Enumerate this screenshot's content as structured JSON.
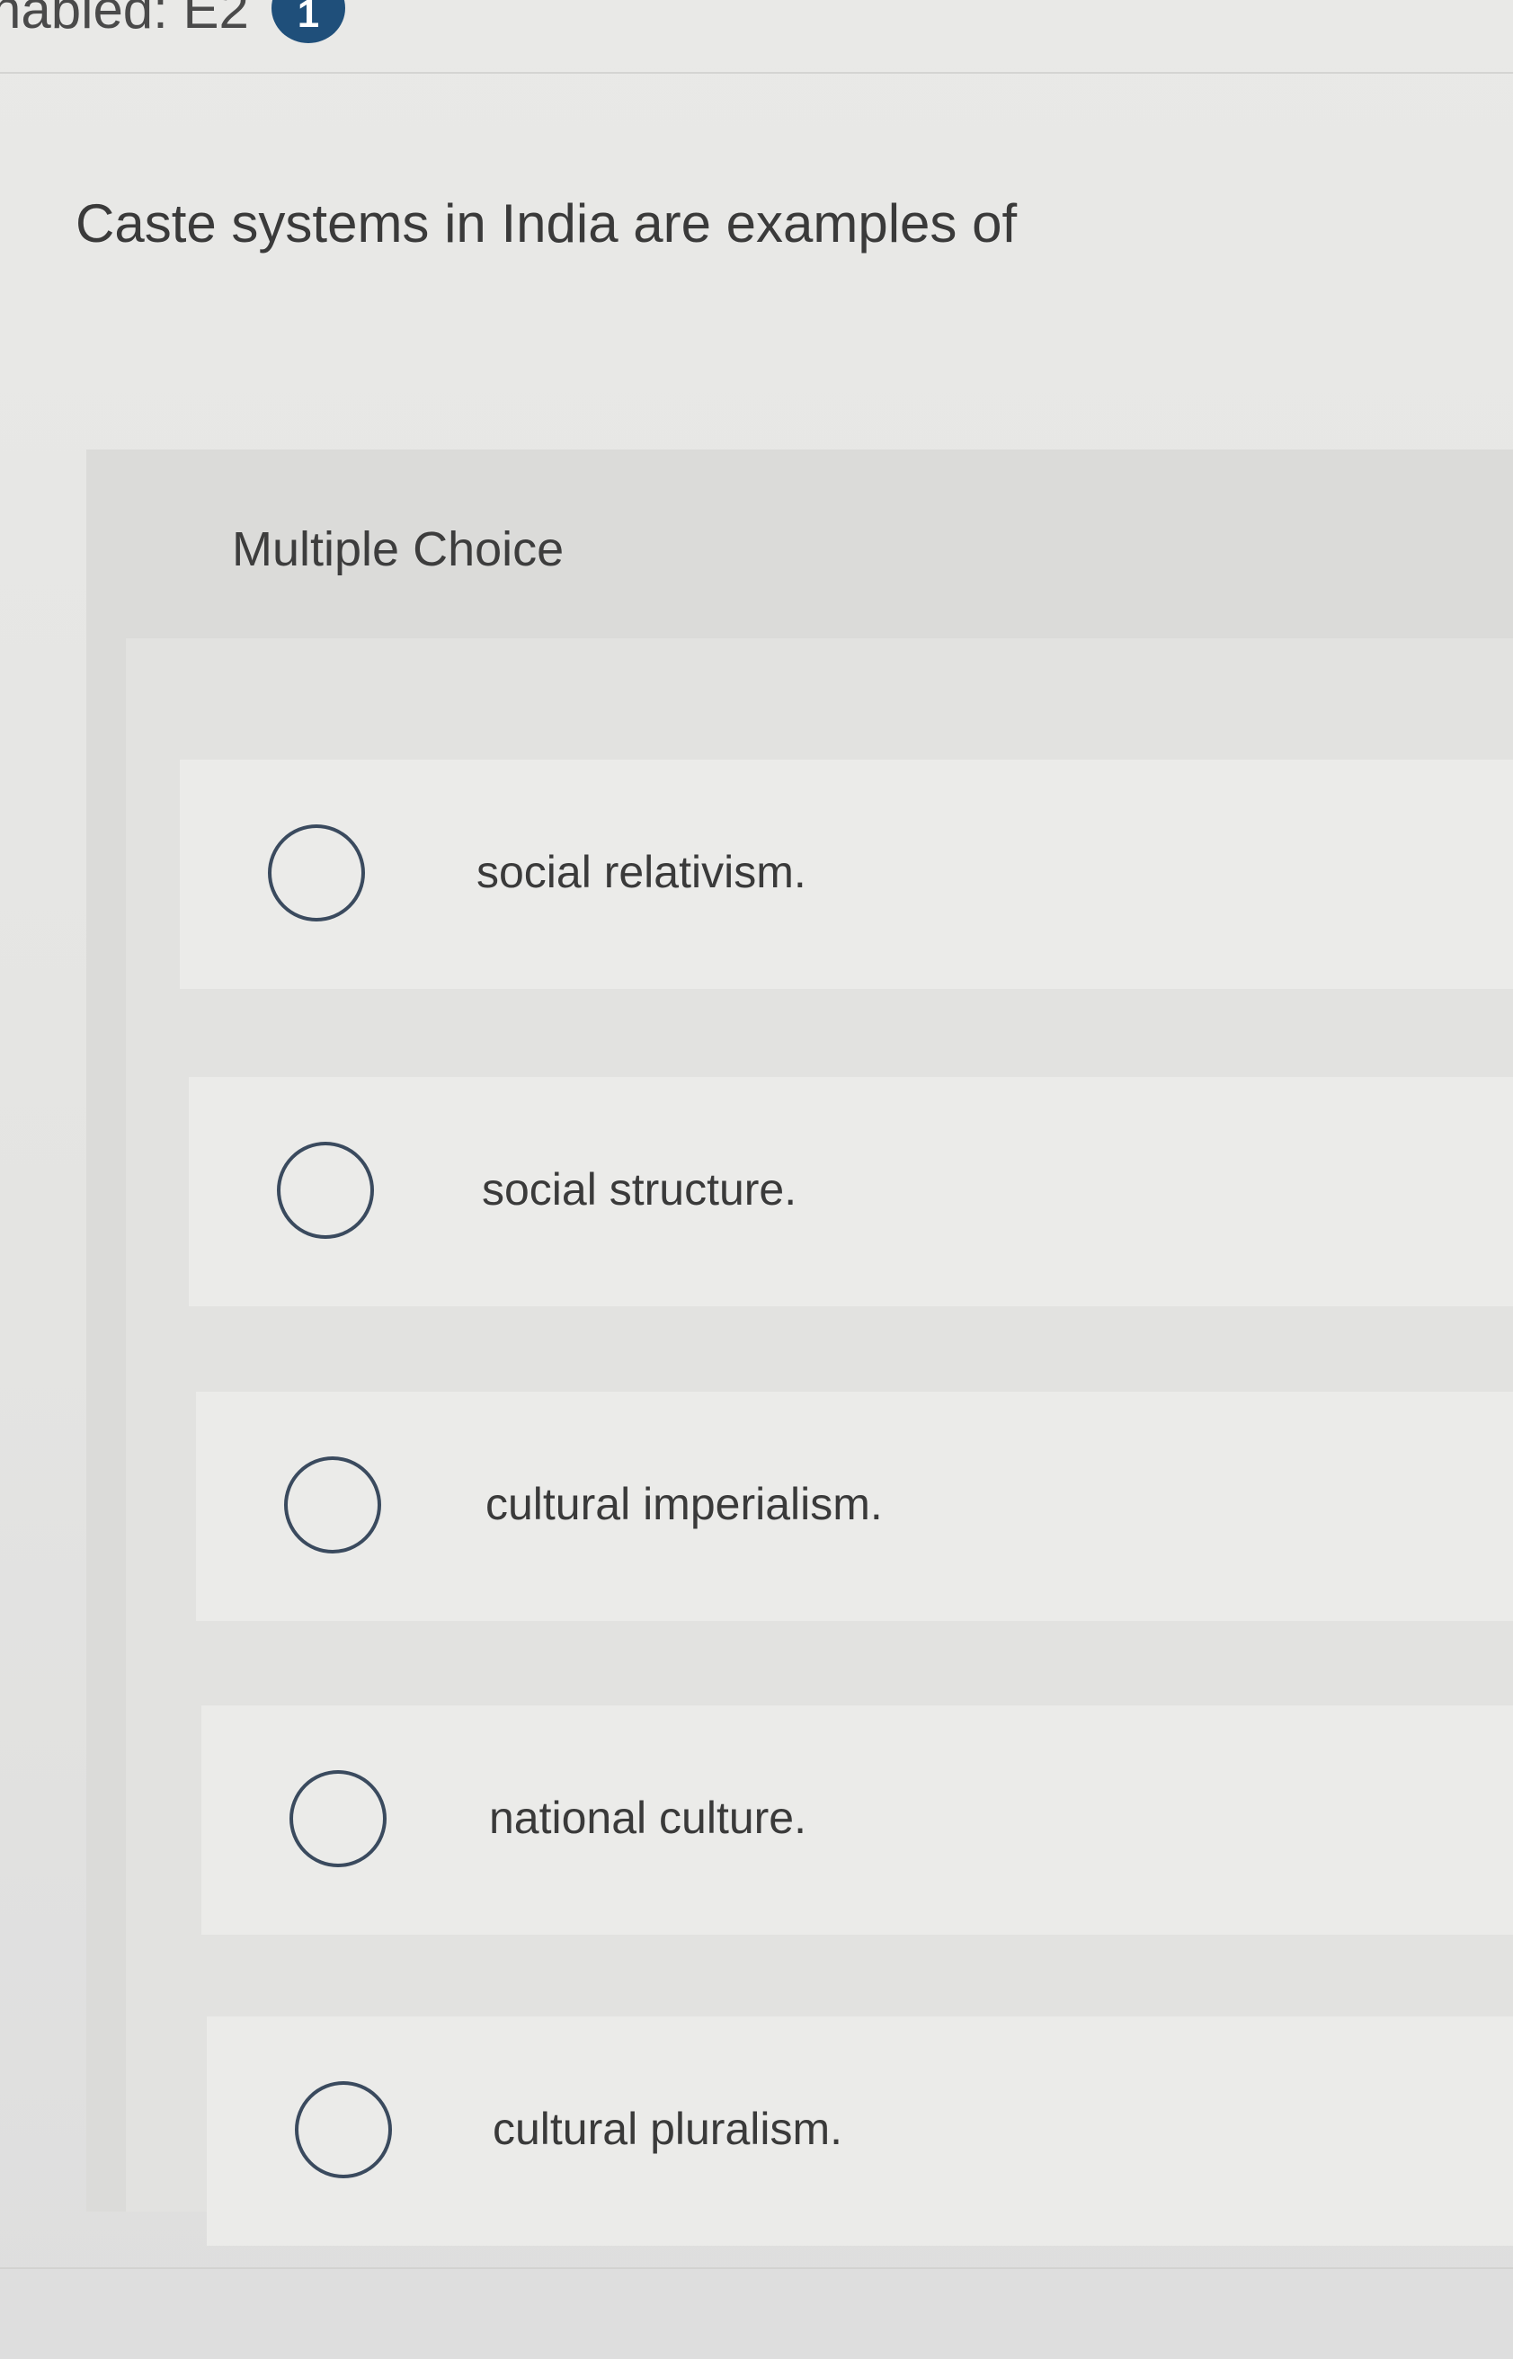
{
  "header": {
    "label": "nabled: E2",
    "badge": "1"
  },
  "question": {
    "prompt": "Caste systems in India are examples of",
    "type_label": "Multiple Choice",
    "options": [
      {
        "label": "social relativism."
      },
      {
        "label": "social structure."
      },
      {
        "label": "cultural imperialism."
      },
      {
        "label": "national culture."
      },
      {
        "label": "cultural pluralism."
      }
    ]
  },
  "colors": {
    "badge": "#1f4f7a",
    "radio_border": "#3a4a5e"
  }
}
